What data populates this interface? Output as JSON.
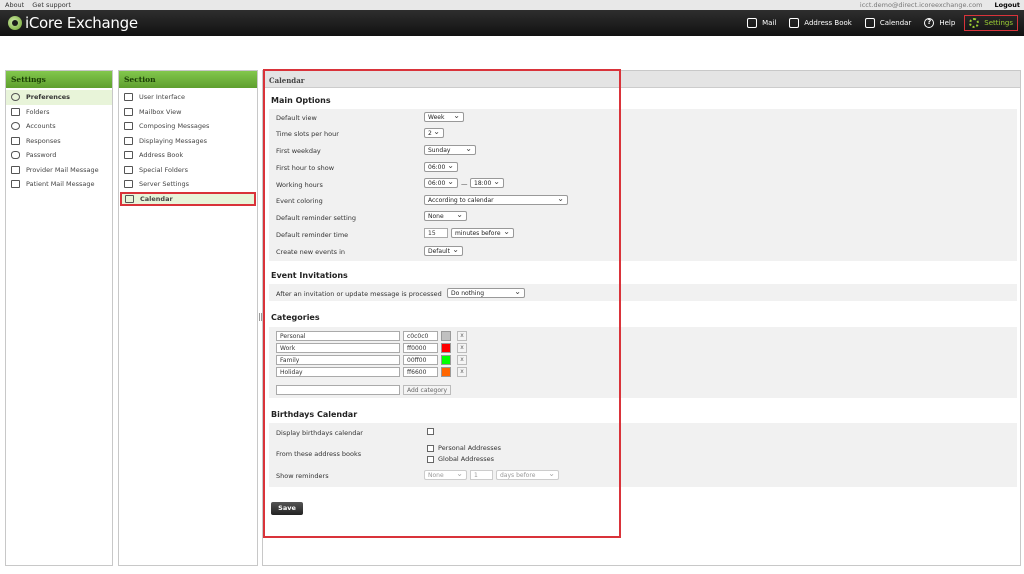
{
  "topbar": {
    "about": "About",
    "support": "Get support",
    "email": "icct.demo@direct.icoreexchange.com",
    "logout": "Logout"
  },
  "header": {
    "logo": "iCore Exchange",
    "nav": [
      {
        "label": "Mail",
        "icon": "mail-icon"
      },
      {
        "label": "Address Book",
        "icon": "address-book-icon"
      },
      {
        "label": "Calendar",
        "icon": "calendar-icon"
      },
      {
        "label": "Help",
        "icon": "help-icon"
      },
      {
        "label": "Settings",
        "icon": "gear-icon"
      }
    ]
  },
  "settings_panel": {
    "title": "Settings",
    "items": [
      "Preferences",
      "Folders",
      "Accounts",
      "Responses",
      "Password",
      "Provider Mail Message",
      "Patient Mail Message"
    ]
  },
  "section_panel": {
    "title": "Section",
    "items": [
      "User Interface",
      "Mailbox View",
      "Composing Messages",
      "Displaying Messages",
      "Address Book",
      "Special Folders",
      "Server Settings",
      "Calendar"
    ]
  },
  "main": {
    "title": "Calendar",
    "main_options": {
      "title": "Main Options",
      "default_view": {
        "label": "Default view",
        "value": "Week"
      },
      "time_slots": {
        "label": "Time slots per hour",
        "value": "2"
      },
      "first_weekday": {
        "label": "First weekday",
        "value": "Sunday"
      },
      "first_hour": {
        "label": "First hour to show",
        "value": "06:00"
      },
      "working_hours": {
        "label": "Working hours",
        "from": "06:00",
        "sep": "—",
        "to": "18:00"
      },
      "event_coloring": {
        "label": "Event coloring",
        "value": "According to calendar"
      },
      "default_reminder": {
        "label": "Default reminder setting",
        "value": "None"
      },
      "reminder_time": {
        "label": "Default reminder time",
        "value": "15",
        "unit": "minutes before"
      },
      "create_events_in": {
        "label": "Create new events in",
        "value": "Default"
      }
    },
    "invitations": {
      "title": "Event Invitations",
      "label": "After an invitation or update message is processed",
      "value": "Do nothing"
    },
    "categories": {
      "title": "Categories",
      "items": [
        {
          "name": "Personal",
          "color": "c0c0c0",
          "swatch": "#c0c0c0"
        },
        {
          "name": "Work",
          "color": "ff0000",
          "swatch": "#ff0000"
        },
        {
          "name": "Family",
          "color": "00ff00",
          "swatch": "#00ff00"
        },
        {
          "name": "Holiday",
          "color": "ff6600",
          "swatch": "#ff6600"
        }
      ],
      "delete": "x",
      "new_name": "",
      "add_label": "Add category"
    },
    "birthdays": {
      "title": "Birthdays Calendar",
      "display_label": "Display birthdays calendar",
      "from_label": "From these address books",
      "books": [
        "Personal Addresses",
        "Global Addresses"
      ],
      "reminders_label": "Show reminders",
      "reminder_type": "None",
      "reminder_count": "1",
      "reminder_unit": "days before"
    },
    "save_label": "Save"
  }
}
